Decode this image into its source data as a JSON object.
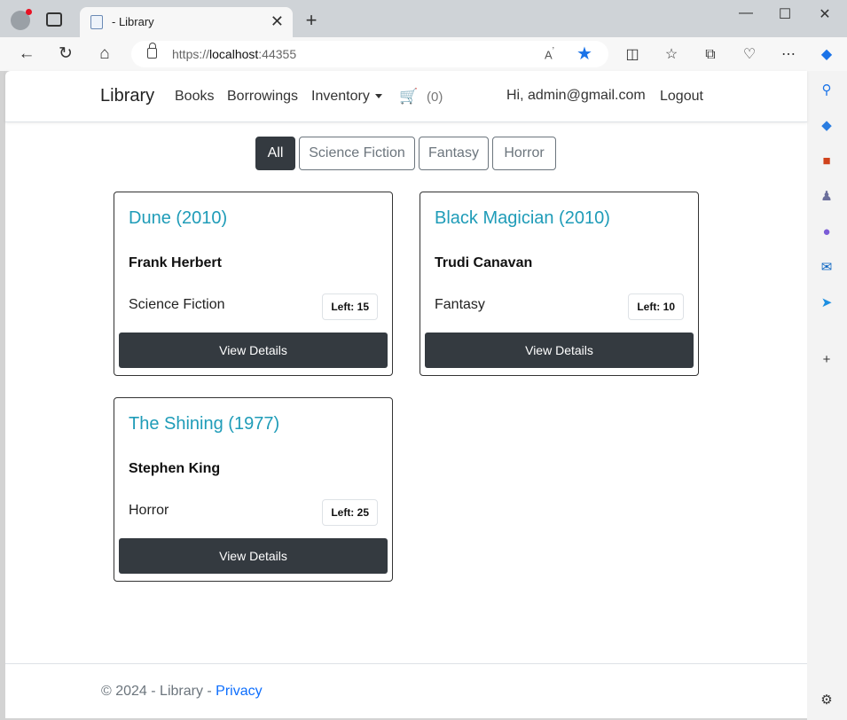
{
  "browser": {
    "tab_title": "- Library",
    "url_scheme": "https://",
    "url_host": "localhost",
    "url_port": ":44355"
  },
  "navbar": {
    "brand": "Library",
    "links": [
      "Books",
      "Borrowings",
      "Inventory"
    ],
    "cart_count": "(0)",
    "greeting": "Hi, admin@gmail.com",
    "logout": "Logout"
  },
  "filters": [
    "All",
    "Science Fiction",
    "Fantasy",
    "Horror"
  ],
  "books": [
    {
      "title": "Dune (2010)",
      "author": "Frank Herbert",
      "genre": "Science Fiction",
      "left": "Left: 15",
      "button": "View Details"
    },
    {
      "title": "Black Magician (2010)",
      "author": "Trudi Canavan",
      "genre": "Fantasy",
      "left": "Left: 10",
      "button": "View Details"
    },
    {
      "title": "The Shining (1977)",
      "author": "Stephen King",
      "genre": "Horror",
      "left": "Left: 25",
      "button": "View Details"
    }
  ],
  "footer": {
    "text": "© 2024 - Library - ",
    "link": "Privacy"
  },
  "colors": {
    "accent_title": "#1f9cb8",
    "dark_button": "#343a40",
    "link": "#0d6efd",
    "favorite_star": "#1a73e8"
  }
}
